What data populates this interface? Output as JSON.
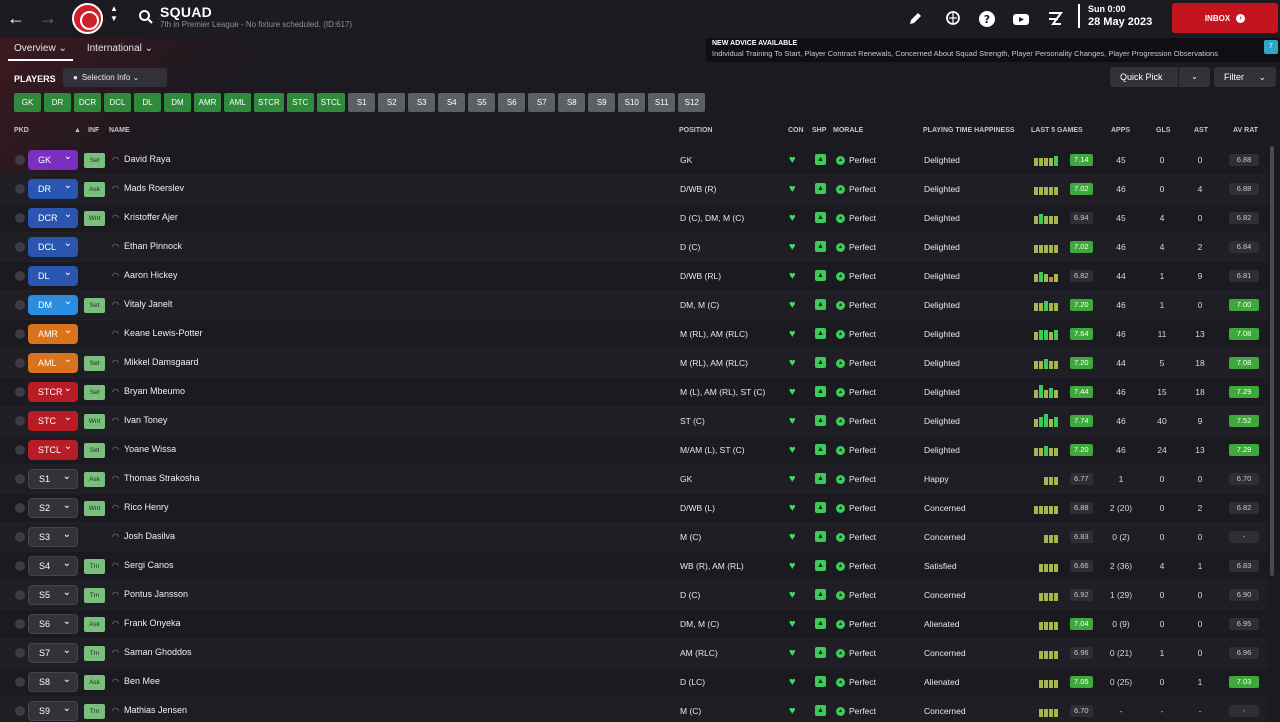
{
  "header": {
    "title": "SQUAD",
    "subtitle": "7th in Premier League - No fixture scheduled. (ID:617)",
    "date_day": "Sun 0:00",
    "date_full": "28 May 2023",
    "inbox_label": "INBOX"
  },
  "tabs": [
    {
      "label": "Overview ⌄"
    },
    {
      "label": "International ⌄"
    }
  ],
  "advice": {
    "title": "NEW ADVICE AVAILABLE",
    "text": "Individual Training To Start, Player Contract Renewals, Concerned About Squad Strength, Player Personality Changes, Player Progression Observations",
    "badge": "7"
  },
  "toolbar": {
    "players_label": "PLAYERS",
    "selection_info": "Selection Info ⌄",
    "quick_pick": "Quick Pick",
    "filter": "Filter"
  },
  "position_buttons": [
    {
      "label": "GK",
      "kind": "g"
    },
    {
      "label": "DR",
      "kind": "g"
    },
    {
      "label": "DCR",
      "kind": "g"
    },
    {
      "label": "DCL",
      "kind": "g"
    },
    {
      "label": "DL",
      "kind": "g"
    },
    {
      "label": "DM",
      "kind": "g"
    },
    {
      "label": "AMR",
      "kind": "g"
    },
    {
      "label": "AML",
      "kind": "g"
    },
    {
      "label": "STCR",
      "kind": "g"
    },
    {
      "label": "STC",
      "kind": "g"
    },
    {
      "label": "STCL",
      "kind": "g"
    },
    {
      "label": "S1",
      "kind": "s"
    },
    {
      "label": "S2",
      "kind": "s"
    },
    {
      "label": "S3",
      "kind": "s"
    },
    {
      "label": "S4",
      "kind": "s"
    },
    {
      "label": "S5",
      "kind": "s"
    },
    {
      "label": "S6",
      "kind": "s"
    },
    {
      "label": "S7",
      "kind": "s"
    },
    {
      "label": "S8",
      "kind": "s"
    },
    {
      "label": "S9",
      "kind": "s"
    },
    {
      "label": "S10",
      "kind": "s"
    },
    {
      "label": "S11",
      "kind": "s"
    },
    {
      "label": "S12",
      "kind": "s"
    }
  ],
  "columns": {
    "pkd": "PKD",
    "inf": "INF",
    "name": "NAME",
    "position": "POSITION",
    "con": "CON",
    "shp": "SHP",
    "morale": "MORALE",
    "happiness": "PLAYING TIME HAPPINESS",
    "last5": "LAST 5 GAMES",
    "apps": "APPS",
    "gls": "GLS",
    "ast": "AST",
    "avrat": "AV RAT"
  },
  "colors": {
    "gk": "#7b2fbf",
    "def": "#2a55b0",
    "dm": "#2b8de0",
    "mid": "#d9731c",
    "att": "#b81c24",
    "sub": "#33323a"
  },
  "players": [
    {
      "pkd": "GK",
      "group": "gk",
      "inf": "Set",
      "name": "David Raya",
      "pos": "GK",
      "morale": "Perfect",
      "happy": "Delighted",
      "bars": [
        3,
        3,
        3,
        3,
        4
      ],
      "last5": "7.14",
      "last5_hi": true,
      "apps": "45",
      "gls": "0",
      "ast": "0",
      "avrat": "6.88",
      "avrat_hi": false
    },
    {
      "pkd": "DR",
      "group": "def",
      "inf": "Ask",
      "name": "Mads Roerslev",
      "pos": "D/WB (R)",
      "morale": "Perfect",
      "happy": "Delighted",
      "bars": [
        3,
        3,
        3,
        3,
        3
      ],
      "last5": "7.02",
      "last5_hi": true,
      "apps": "46",
      "gls": "0",
      "ast": "4",
      "avrat": "6.88",
      "avrat_hi": false
    },
    {
      "pkd": "DCR",
      "group": "def",
      "inf": "Wnt",
      "name": "Kristoffer Ajer",
      "pos": "D (C), DM, M (C)",
      "morale": "Perfect",
      "happy": "Delighted",
      "bars": [
        3,
        4,
        3,
        3,
        3
      ],
      "last5": "6.94",
      "last5_hi": false,
      "apps": "45",
      "gls": "4",
      "ast": "0",
      "avrat": "6.82",
      "avrat_hi": false
    },
    {
      "pkd": "DCL",
      "group": "def",
      "inf": "",
      "name": "Ethan Pinnock",
      "pos": "D (C)",
      "morale": "Perfect",
      "happy": "Delighted",
      "bars": [
        3,
        3,
        3,
        3,
        3
      ],
      "last5": "7.02",
      "last5_hi": true,
      "apps": "46",
      "gls": "4",
      "ast": "2",
      "avrat": "6.84",
      "avrat_hi": false
    },
    {
      "pkd": "DL",
      "group": "def",
      "inf": "",
      "name": "Aaron Hickey",
      "pos": "D/WB (RL)",
      "morale": "Perfect",
      "happy": "Delighted",
      "bars": [
        3,
        4,
        3,
        2,
        3
      ],
      "last5": "6.82",
      "last5_hi": false,
      "apps": "44",
      "gls": "1",
      "ast": "9",
      "avrat": "6.81",
      "avrat_hi": false
    },
    {
      "pkd": "DM",
      "group": "dm",
      "inf": "Set",
      "name": "Vitaly Janelt",
      "pos": "DM, M (C)",
      "morale": "Perfect",
      "happy": "Delighted",
      "bars": [
        3,
        3,
        4,
        3,
        3
      ],
      "last5": "7.20",
      "last5_hi": true,
      "apps": "46",
      "gls": "1",
      "ast": "0",
      "avrat": "7.00",
      "avrat_hi": true
    },
    {
      "pkd": "AMR",
      "group": "mid",
      "inf": "",
      "name": "Keane Lewis-Potter",
      "pos": "M (RL), AM (RLC)",
      "morale": "Perfect",
      "happy": "Delighted",
      "bars": [
        3,
        4,
        4,
        3,
        4
      ],
      "last5": "7.64",
      "last5_hi": true,
      "apps": "46",
      "gls": "11",
      "ast": "13",
      "avrat": "7.08",
      "avrat_hi": true
    },
    {
      "pkd": "AML",
      "group": "mid",
      "inf": "Set",
      "name": "Mikkel Damsgaard",
      "pos": "M (RL), AM (RLC)",
      "morale": "Perfect",
      "happy": "Delighted",
      "bars": [
        3,
        3,
        4,
        3,
        3
      ],
      "last5": "7.20",
      "last5_hi": true,
      "apps": "44",
      "gls": "5",
      "ast": "18",
      "avrat": "7.08",
      "avrat_hi": true
    },
    {
      "pkd": "STCR",
      "group": "att",
      "inf": "Set",
      "name": "Bryan Mbeumo",
      "pos": "M (L), AM (RL), ST (C)",
      "morale": "Perfect",
      "happy": "Delighted",
      "bars": [
        3,
        5,
        3,
        4,
        3
      ],
      "last5": "7.44",
      "last5_hi": true,
      "apps": "46",
      "gls": "15",
      "ast": "18",
      "avrat": "7.29",
      "avrat_hi": true
    },
    {
      "pkd": "STC",
      "group": "att",
      "inf": "Wnt",
      "name": "Ivan Toney",
      "pos": "ST (C)",
      "morale": "Perfect",
      "happy": "Delighted",
      "bars": [
        3,
        4,
        5,
        3,
        4
      ],
      "last5": "7.74",
      "last5_hi": true,
      "apps": "46",
      "gls": "40",
      "ast": "9",
      "avrat": "7.52",
      "avrat_hi": true
    },
    {
      "pkd": "STCL",
      "group": "att",
      "inf": "Set",
      "name": "Yoane Wissa",
      "pos": "M/AM (L), ST (C)",
      "morale": "Perfect",
      "happy": "Delighted",
      "bars": [
        3,
        3,
        4,
        3,
        3
      ],
      "last5": "7.20",
      "last5_hi": true,
      "apps": "46",
      "gls": "24",
      "ast": "13",
      "avrat": "7.29",
      "avrat_hi": true
    },
    {
      "pkd": "S1",
      "group": "sub",
      "inf": "Ask",
      "name": "Thomas Strakosha",
      "pos": "GK",
      "morale": "Perfect",
      "happy": "Happy",
      "bars": [
        0,
        0,
        3,
        3,
        3
      ],
      "last5": "6.77",
      "last5_hi": false,
      "apps": "1",
      "gls": "0",
      "ast": "0",
      "avrat": "6.70",
      "avrat_hi": false
    },
    {
      "pkd": "S2",
      "group": "sub",
      "inf": "Wnt",
      "name": "Rico Henry",
      "pos": "D/WB (L)",
      "morale": "Perfect",
      "happy": "Concerned",
      "bars": [
        3,
        3,
        3,
        3,
        3
      ],
      "last5": "6.88",
      "last5_hi": false,
      "apps": "2 (20)",
      "gls": "0",
      "ast": "2",
      "avrat": "6.82",
      "avrat_hi": false
    },
    {
      "pkd": "S3",
      "group": "sub",
      "inf": "",
      "name": "Josh Dasilva",
      "pos": "M (C)",
      "morale": "Perfect",
      "happy": "Concerned",
      "bars": [
        0,
        0,
        3,
        3,
        3
      ],
      "last5": "6.83",
      "last5_hi": false,
      "apps": "0 (2)",
      "gls": "0",
      "ast": "0",
      "avrat": "-",
      "avrat_hi": false
    },
    {
      "pkd": "S4",
      "group": "sub",
      "inf": "Trn",
      "name": "Sergi Canos",
      "pos": "WB (R), AM (RL)",
      "morale": "Perfect",
      "happy": "Satisfied",
      "bars": [
        0,
        3,
        3,
        3,
        3
      ],
      "last5": "6.66",
      "last5_hi": false,
      "apps": "2 (36)",
      "gls": "4",
      "ast": "1",
      "avrat": "6.83",
      "avrat_hi": false
    },
    {
      "pkd": "S5",
      "group": "sub",
      "inf": "Trn",
      "name": "Pontus Jansson",
      "pos": "D (C)",
      "morale": "Perfect",
      "happy": "Concerned",
      "bars": [
        0,
        3,
        3,
        3,
        3
      ],
      "last5": "6.92",
      "last5_hi": false,
      "apps": "1 (29)",
      "gls": "0",
      "ast": "0",
      "avrat": "6.90",
      "avrat_hi": false
    },
    {
      "pkd": "S6",
      "group": "sub",
      "inf": "Ask",
      "name": "Frank Onyeka",
      "pos": "DM, M (C)",
      "morale": "Perfect",
      "happy": "Alienated",
      "bars": [
        0,
        3,
        3,
        3,
        3
      ],
      "last5": "7.04",
      "last5_hi": true,
      "apps": "0 (9)",
      "gls": "0",
      "ast": "0",
      "avrat": "6.95",
      "avrat_hi": false
    },
    {
      "pkd": "S7",
      "group": "sub",
      "inf": "Trn",
      "name": "Saman Ghoddos",
      "pos": "AM (RLC)",
      "morale": "Perfect",
      "happy": "Concerned",
      "bars": [
        0,
        3,
        3,
        3,
        3
      ],
      "last5": "6.96",
      "last5_hi": false,
      "apps": "0 (21)",
      "gls": "1",
      "ast": "0",
      "avrat": "6.96",
      "avrat_hi": false
    },
    {
      "pkd": "S8",
      "group": "sub",
      "inf": "Ask",
      "name": "Ben Mee",
      "pos": "D (LC)",
      "morale": "Perfect",
      "happy": "Alienated",
      "bars": [
        0,
        3,
        3,
        3,
        3
      ],
      "last5": "7.05",
      "last5_hi": true,
      "apps": "0 (25)",
      "gls": "0",
      "ast": "1",
      "avrat": "7.03",
      "avrat_hi": true
    },
    {
      "pkd": "S9",
      "group": "sub",
      "inf": "Trn",
      "name": "Mathias Jensen",
      "pos": "M (C)",
      "morale": "Perfect",
      "happy": "Concerned",
      "bars": [
        0,
        3,
        3,
        3,
        3
      ],
      "last5": "6.70",
      "last5_hi": false,
      "apps": "-",
      "gls": "-",
      "ast": "-",
      "avrat": "-",
      "avrat_hi": false
    }
  ]
}
